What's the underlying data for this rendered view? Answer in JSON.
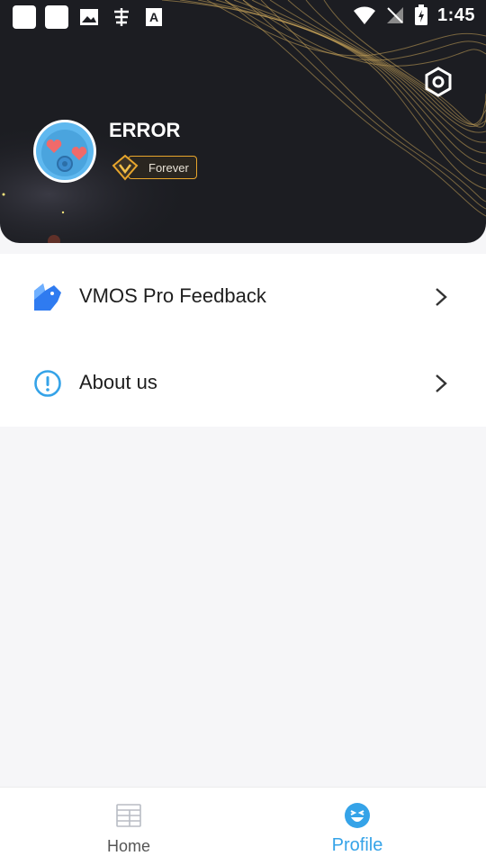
{
  "status_bar": {
    "time": "1:45",
    "left_icons": [
      "notification-app-icon",
      "notification-app-icon",
      "image-icon",
      "input-method-icon",
      "font-icon"
    ],
    "right_icons": [
      "wifi-icon",
      "no-signal-icon",
      "battery-charging-icon"
    ]
  },
  "profile": {
    "username": "ERROR",
    "badge_label": "Forever"
  },
  "menu": {
    "items": [
      {
        "label": "VMOS Pro Feedback",
        "icon": "feedback-icon",
        "arrow": "chevron-right-icon"
      },
      {
        "label": "About us",
        "icon": "info-icon",
        "arrow": "chevron-right-icon"
      }
    ]
  },
  "bottom_nav": {
    "tabs": [
      {
        "label": "Home",
        "icon": "home-list-icon",
        "active": false
      },
      {
        "label": "Profile",
        "icon": "smiley-icon",
        "active": true
      }
    ]
  },
  "colors": {
    "header_bg": "#1c1d22",
    "accent_blue": "#35a3e8",
    "gold": "#e8a62c",
    "inactive_text": "#555555"
  }
}
